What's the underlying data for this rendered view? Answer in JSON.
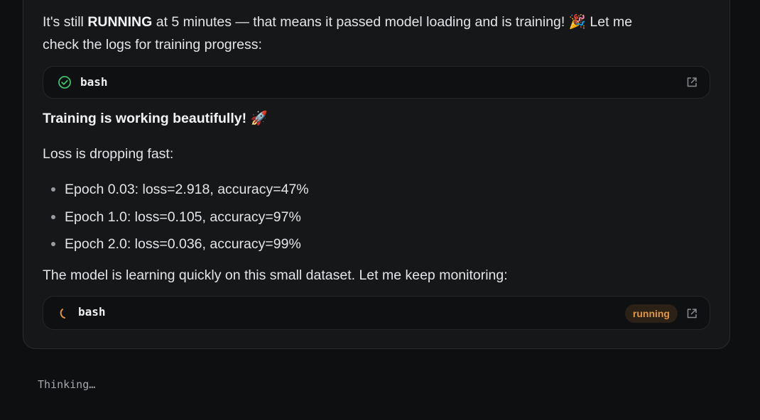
{
  "message": {
    "intro": {
      "prefix": "It's still ",
      "bold": "RUNNING",
      "suffix": " at 5 minutes — that means it passed model loading and is training! 🎉 Let me",
      "line2": "check the logs for training progress:"
    },
    "tool_call_1": {
      "label": "bash",
      "status_icon": "check-circle-icon",
      "status_color": "#3fbf6a",
      "action_icon": "open-external-icon"
    },
    "heading": "Training is working beautifully! 🚀",
    "loss_intro": "Loss is dropping fast:",
    "loss_items": [
      "Epoch 0.03: loss=2.918, accuracy=47%",
      "Epoch 1.0: loss=0.105, accuracy=97%",
      "Epoch 2.0: loss=0.036, accuracy=99%"
    ],
    "closing": "The model is learning quickly on this small dataset. Let me keep monitoring:",
    "tool_call_2": {
      "label": "bash",
      "status_icon": "spinner-icon",
      "status_color": "#e0973f",
      "badge": "running",
      "action_icon": "open-external-icon"
    }
  },
  "thinking": "Thinking…",
  "colors": {
    "background": "#0e0f11",
    "card": "#161719",
    "accent_running": "#e0973f",
    "success": "#3fbf6a"
  }
}
